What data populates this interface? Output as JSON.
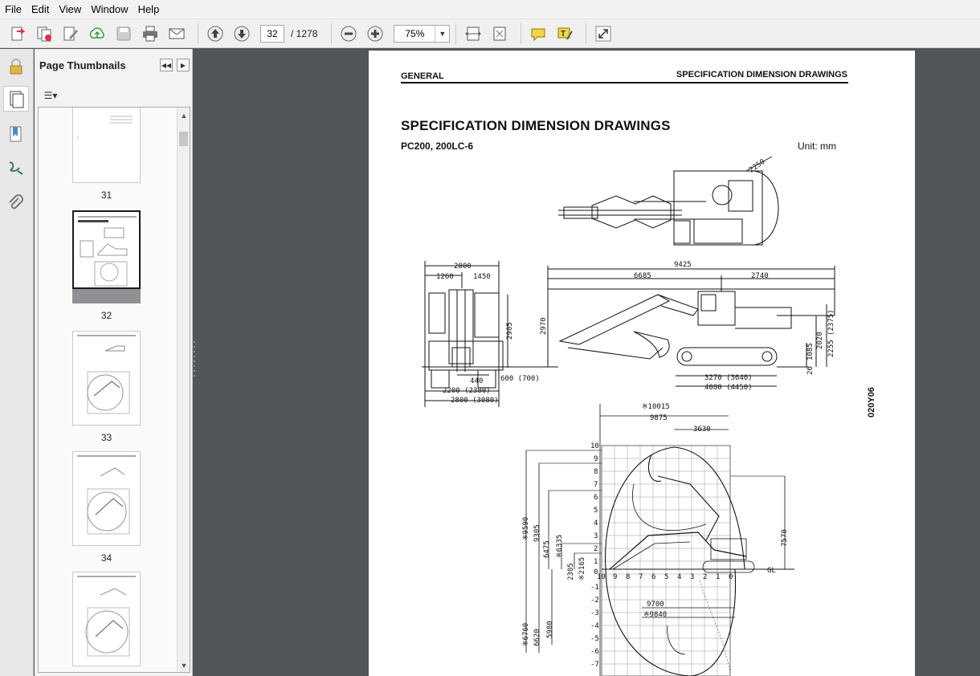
{
  "menu": [
    "File",
    "Edit",
    "View",
    "Window",
    "Help"
  ],
  "toolbar": {
    "current_page": "32",
    "page_total": "/ 1278",
    "zoom": "75%",
    "buttons": [
      "create-icon",
      "combine-icon",
      "edit-icon",
      "upload-icon",
      "save-icon",
      "print-icon",
      "email-icon",
      "previous-page-icon",
      "next-page-icon",
      "zoom-out-icon",
      "zoom-in-icon",
      "fit-width-icon",
      "fit-page-icon",
      "comment-icon",
      "highlight-icon",
      "expand-icon"
    ]
  },
  "sidebar": {
    "title": "Page Thumbnails",
    "thumbnails": [
      {
        "label": "31"
      },
      {
        "label": "32",
        "selected": true
      },
      {
        "label": "33"
      },
      {
        "label": "34"
      },
      {
        "label": ""
      }
    ]
  },
  "document": {
    "header_left": "GENERAL",
    "header_right": "SPECIFICATION DIMENSION DRAWINGS",
    "title": "SPECIFICATION DIMENSION DRAWINGS",
    "model": "PC200, 200LC-6",
    "unit": "Unit: mm",
    "code": "020Y06",
    "dims_top": [
      "2250"
    ],
    "dims_front": [
      "2800",
      "1260",
      "1450",
      "2905",
      "440",
      "600 (700)",
      "2200 (2380)",
      "2800 (3080)"
    ],
    "dims_side": [
      "9425",
      "6685",
      "2740",
      "2970",
      "2020",
      "2255 (2375)",
      "1085",
      "26",
      "3270 (3640)",
      "4080 (4450)"
    ],
    "dims_range": [
      "※10015",
      "9875",
      "3630",
      "※9590",
      "9305",
      "6475",
      "※6335",
      "2305",
      "※2165",
      "7570",
      "9700",
      "※9840",
      "※6760",
      "6620",
      "5980",
      "GL"
    ],
    "grid_y_labels": [
      "10",
      "9",
      "8",
      "7",
      "6",
      "5",
      "4",
      "3",
      "2",
      "1",
      "0",
      "-1",
      "-2",
      "-3",
      "-4",
      "-5",
      "-6",
      "-7"
    ],
    "grid_x_labels": [
      "10",
      "9",
      "8",
      "7",
      "6",
      "5",
      "4",
      "3",
      "2",
      "1",
      "0"
    ]
  },
  "colors": {
    "app_bg": "#525659",
    "toolbar_bg": "#f0f0f0",
    "arrow_blue": "#2a62b0",
    "comment_yellow": "#f2d542"
  }
}
